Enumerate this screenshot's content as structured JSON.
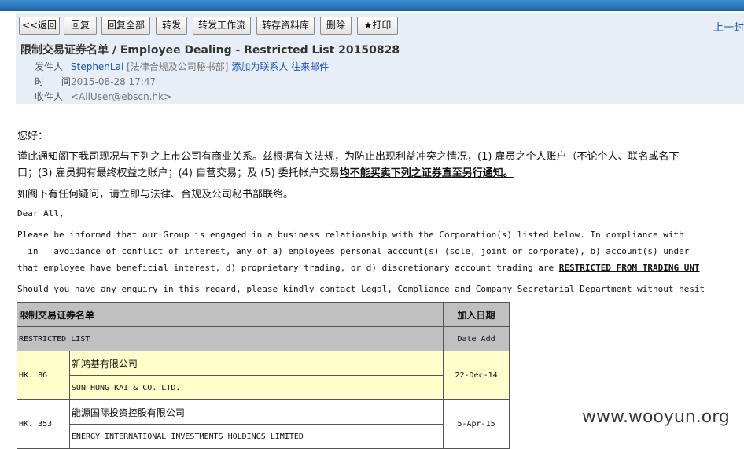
{
  "toolbar": {
    "back": "<<返回",
    "reply": "回复",
    "reply_all": "回复全部",
    "forward": "转发",
    "forward_workflow": "转发工作流",
    "save_to_library": "转存资料库",
    "delete": "删除",
    "print": "★打印",
    "prev_link": "上一封"
  },
  "email": {
    "subject": "限制交易证券名单 / Employee Dealing - Restricted List 20150828",
    "sender_label": "发件人",
    "sender_name": "StephenLai",
    "sender_dept": "[法律合规及公司秘书部]",
    "add_contact": "添加为联系人",
    "history": "往来邮件",
    "time_label": "时 间",
    "time_value": "2015-08-28 17:47",
    "to_label": "收件人",
    "to_value": "<AllUser@ebscn.hk>"
  },
  "body": {
    "greeting_cn": "您好：",
    "para1_cn_line1": "谨此通知阁下我司现况与下列之上市公司有商业关系。兹根据有关法规，为防止出现利益冲突之情况，(1) 雇员之个人账户（不论个人、联名或名下",
    "para1_cn_line2_start": "口；(3) 雇员拥有最终权益之账户；(4) 自营交易；及 (5) 委托帐户交易",
    "para1_cn_line2_bold": "均不能买卖下列之证券直至另行通知。",
    "para2_cn": "如阁下有任何疑问，请立即与法律、合规及公司秘书部联络。",
    "greeting_en": "Dear All,",
    "para1_en_line1": "Please be informed that our Group is engaged in a business relationship with the Corporation(s) listed below.   In compliance with",
    "para1_en_line2": "  in   avoidance of conflict of interest, any of a) employees personal account(s) (sole, joint or corporate), b) account(s) under",
    "para1_en_line3_start": "that employee have beneficial interest, d) proprietary trading, or d) discretionary account trading are ",
    "para1_en_line3_bold": "RESTRICTED FROM TRADING UNT",
    "para2_en": "Should you have any enquiry in this regard, please kindly contact Legal, Compliance and Company Secretarial Department without hesit"
  },
  "table": {
    "header_cn": "限制交易证券名单",
    "header_date_cn": "加入日期",
    "header_en": "RESTRICTED LIST",
    "header_date_en": "Date Add",
    "rows": [
      {
        "code": "HK. 86",
        "name_cn": "新鸿基有限公司",
        "name_en": "SUN HUNG KAI & CO. LTD.",
        "date": "22-Dec-14"
      },
      {
        "code": "HK. 353",
        "name_cn": "能源国际投资控股有限公司",
        "name_en": "ENERGY INTERNATIONAL INVESTMENTS HOLDINGS LIMITED",
        "date": "5-Apr-15"
      }
    ]
  },
  "watermark": "www.wooyun.org"
}
